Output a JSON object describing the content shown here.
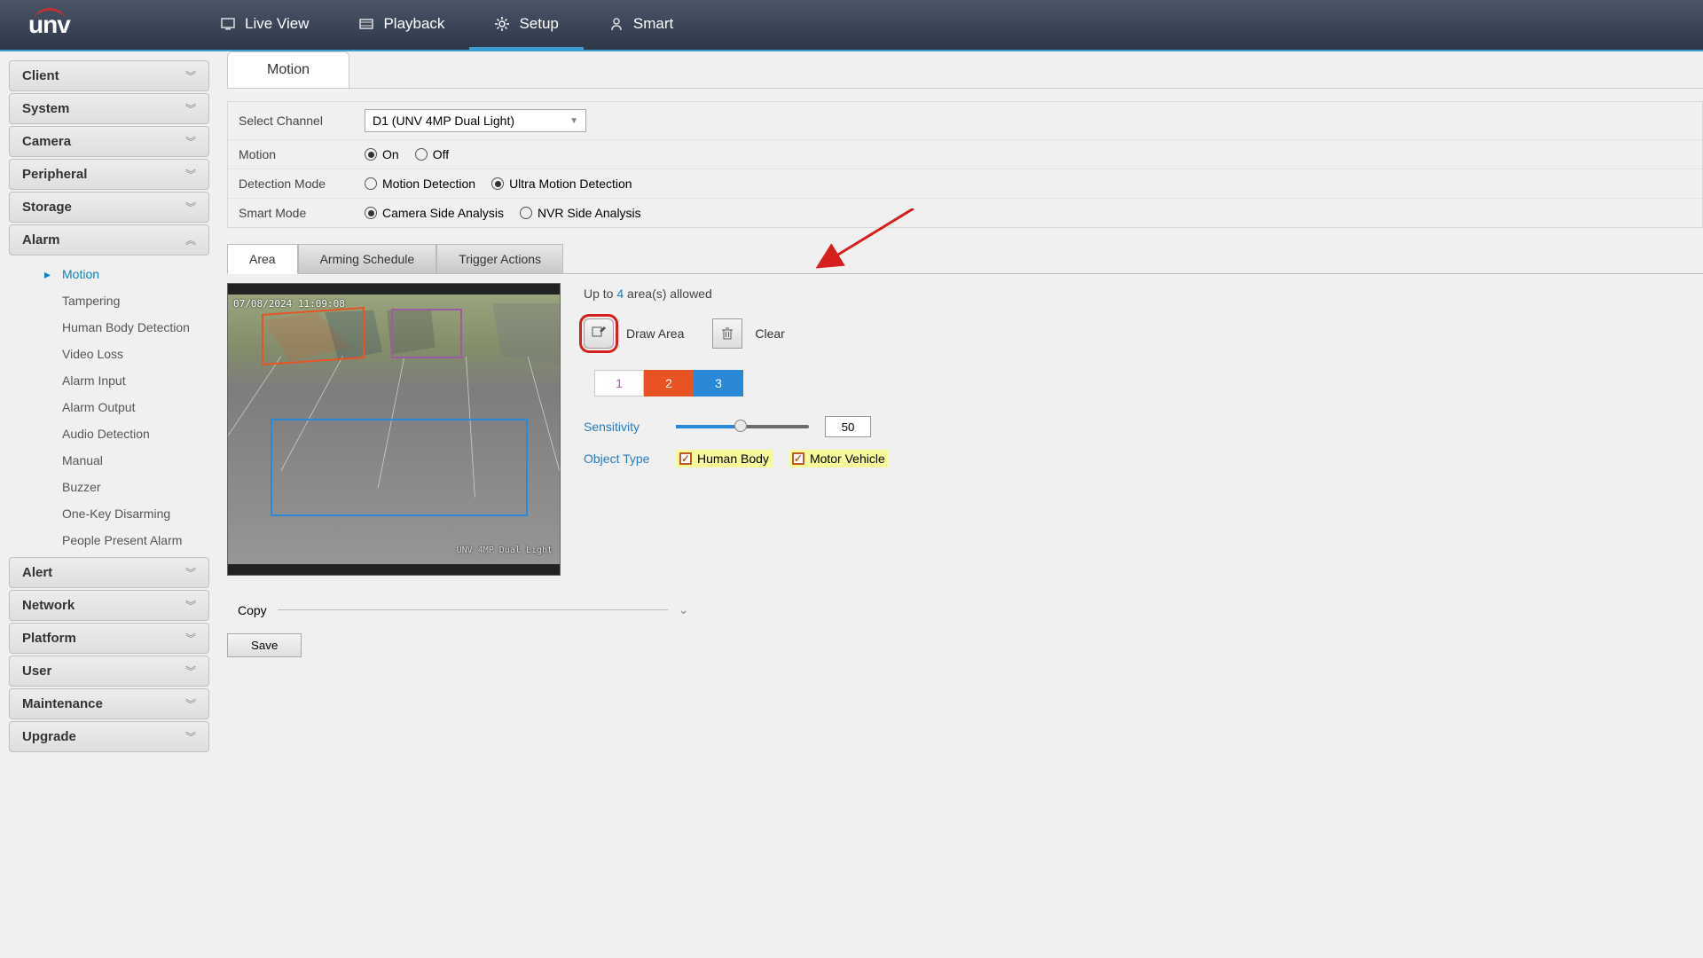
{
  "brand": "unv",
  "nav": [
    {
      "label": "Live View",
      "icon": "monitor"
    },
    {
      "label": "Playback",
      "icon": "film"
    },
    {
      "label": "Setup",
      "icon": "gear",
      "active": true
    },
    {
      "label": "Smart",
      "icon": "person"
    }
  ],
  "sidebar": [
    {
      "label": "Client",
      "expanded": false
    },
    {
      "label": "System",
      "expanded": false
    },
    {
      "label": "Camera",
      "expanded": false
    },
    {
      "label": "Peripheral",
      "expanded": false
    },
    {
      "label": "Storage",
      "expanded": false
    },
    {
      "label": "Alarm",
      "expanded": true,
      "children": [
        {
          "label": "Motion",
          "active": true
        },
        {
          "label": "Tampering"
        },
        {
          "label": "Human Body Detection"
        },
        {
          "label": "Video Loss"
        },
        {
          "label": "Alarm Input"
        },
        {
          "label": "Alarm Output"
        },
        {
          "label": "Audio Detection"
        },
        {
          "label": "Manual"
        },
        {
          "label": "Buzzer"
        },
        {
          "label": "One-Key Disarming"
        },
        {
          "label": "People Present Alarm"
        }
      ]
    },
    {
      "label": "Alert",
      "expanded": false
    },
    {
      "label": "Network",
      "expanded": false
    },
    {
      "label": "Platform",
      "expanded": false
    },
    {
      "label": "User",
      "expanded": false
    },
    {
      "label": "Maintenance",
      "expanded": false
    },
    {
      "label": "Upgrade",
      "expanded": false
    }
  ],
  "page": {
    "title": "Motion",
    "select_channel_label": "Select Channel",
    "select_channel_value": "D1 (UNV 4MP Dual Light)",
    "motion_label": "Motion",
    "motion_options": {
      "on": "On",
      "off": "Off",
      "value": "on"
    },
    "detection_label": "Detection Mode",
    "detection_options": {
      "md": "Motion Detection",
      "umd": "Ultra Motion Detection",
      "value": "umd"
    },
    "smart_label": "Smart Mode",
    "smart_options": {
      "csa": "Camera Side Analysis",
      "nvr": "NVR Side Analysis",
      "value": "csa"
    },
    "sub_tabs": [
      "Area",
      "Arming Schedule",
      "Trigger Actions"
    ],
    "active_sub_tab": 0,
    "areas_allowed_pre": "Up to",
    "areas_allowed_num": "4",
    "areas_allowed_post": "area(s) allowed",
    "draw_area": "Draw Area",
    "clear": "Clear",
    "area_numbers": [
      "1",
      "2",
      "3"
    ],
    "sensitivity_label": "Sensitivity",
    "sensitivity_value": "50",
    "object_type_label": "Object Type",
    "object_types": {
      "human": "Human Body",
      "vehicle": "Motor Vehicle"
    },
    "copy_label": "Copy",
    "save_label": "Save",
    "preview_timestamp": "07/08/2024 11:09:08",
    "preview_caption": "UNV 4MP Dual Light"
  }
}
